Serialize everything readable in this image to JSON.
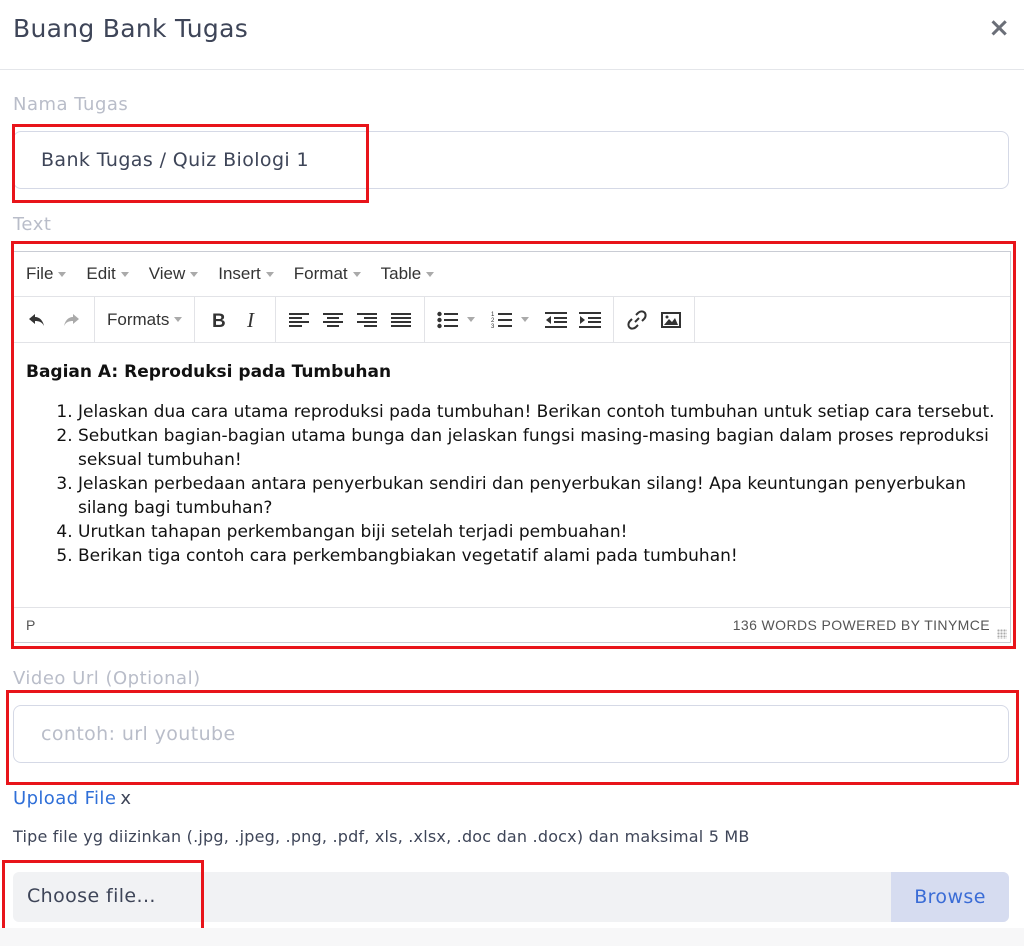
{
  "dialog": {
    "title": "Buang Bank Tugas",
    "close_label": "×"
  },
  "nama_tugas": {
    "label": "Nama Tugas",
    "value": "Bank Tugas / Quiz Biologi 1"
  },
  "text_field": {
    "label": "Text"
  },
  "editor": {
    "menu": [
      "File",
      "Edit",
      "View",
      "Insert",
      "Format",
      "Table"
    ],
    "formats_label": "Formats",
    "heading": "Bagian A: Reproduksi pada Tumbuhan",
    "items": [
      "Jelaskan dua cara utama reproduksi pada tumbuhan! Berikan contoh tumbuhan untuk setiap cara tersebut.",
      "Sebutkan bagian-bagian utama bunga dan jelaskan fungsi masing-masing bagian dalam proses reproduksi seksual tumbuhan!",
      "Jelaskan perbedaan antara penyerbukan sendiri dan penyerbukan silang! Apa keuntungan penyerbukan silang bagi tumbuhan?",
      "Urutkan tahapan perkembangan biji setelah terjadi pembuahan!",
      "Berikan tiga contoh cara perkembangbiakan vegetatif alami pada tumbuhan!"
    ],
    "path": "P",
    "status": "136 WORDS POWERED BY TINYMCE"
  },
  "video_url": {
    "label": "Video Url (Optional)",
    "placeholder": "contoh: url youtube"
  },
  "upload": {
    "link_label": "Upload File",
    "remove_label": "x",
    "hint": "Tipe file yg diizinkan (.jpg, .jpeg, .png, .pdf, xls, .xlsx, .doc dan .docx) dan maksimal 5 MB",
    "file_placeholder": "Choose file...",
    "browse_label": "Browse"
  },
  "colors": {
    "highlight": "#e8141a",
    "link": "#2f6fd8",
    "browse_bg": "#d6dcf0"
  }
}
